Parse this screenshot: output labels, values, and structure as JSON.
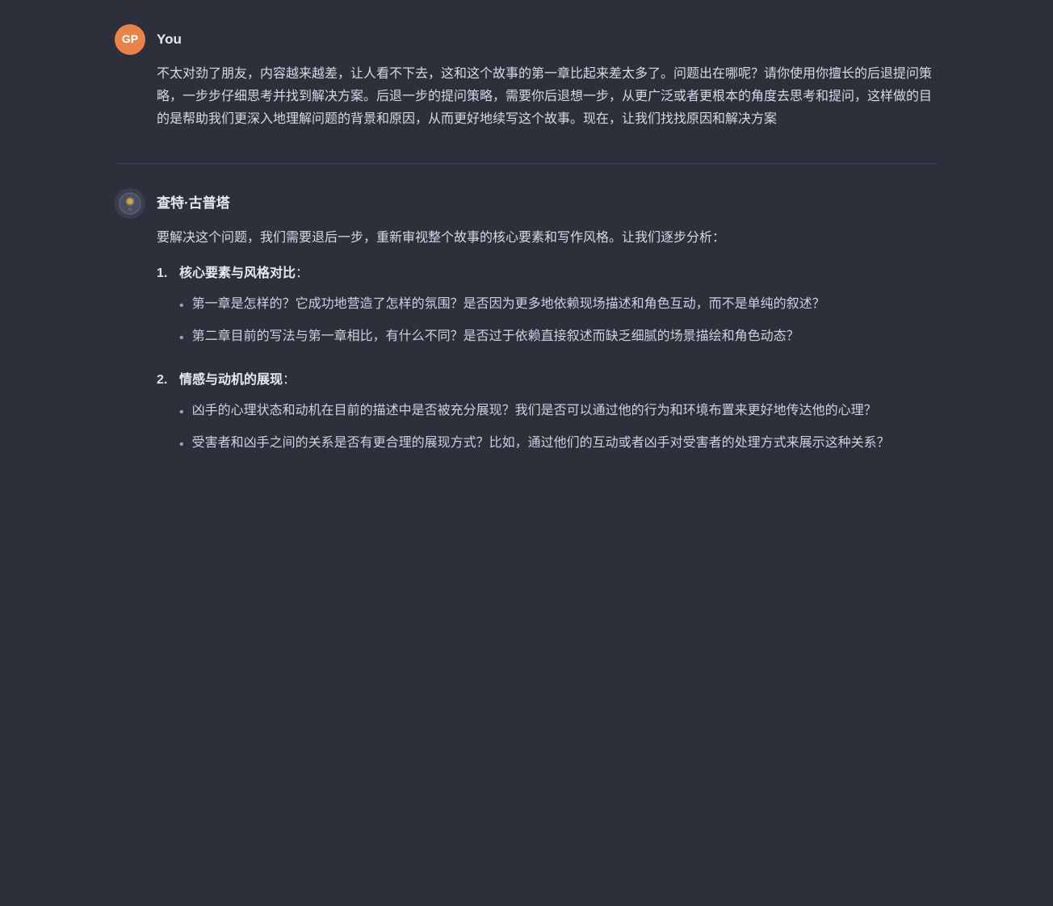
{
  "user": {
    "avatar_label": "GP",
    "name": "You",
    "message": "不太对劲了朋友，内容越来越差，让人看不下去，这和这个故事的第一章比起来差太多了。问题出在哪呢？请你使用你擅长的后退提问策略，一步步仔细思考并找到解决方案。后退一步的提问策略，需要你后退想一步，从更广泛或者更根本的角度去思考和提问，这样做的目的是帮助我们更深入地理解问题的背景和原因，从而更好地续写这个故事。现在，让我们找找原因和解决方案"
  },
  "bot": {
    "name": "查特·古普塔",
    "intro": "要解决这个问题，我们需要退后一步，重新审视整个故事的核心要素和写作风格。让我们逐步分析：",
    "sections": [
      {
        "num": "1.",
        "title": "核心要素与风格对比",
        "colon": "：",
        "bullets": [
          "第一章是怎样的？它成功地营造了怎样的氛围？是否因为更多地依赖现场描述和角色互动，而不是单纯的叙述？",
          "第二章目前的写法与第一章相比，有什么不同？是否过于依赖直接叙述而缺乏细腻的场景描绘和角色动态？"
        ]
      },
      {
        "num": "2.",
        "title": "情感与动机的展现",
        "colon": "：",
        "bullets": [
          "凶手的心理状态和动机在目前的描述中是否被充分展现？我们是否可以通过他的行为和环境布置来更好地传达他的心理？",
          "受害者和凶手之间的关系是否有更合理的展现方式？比如，通过他们的互动或者凶手对受害者的处理方式来展示这种关系？"
        ]
      }
    ]
  }
}
